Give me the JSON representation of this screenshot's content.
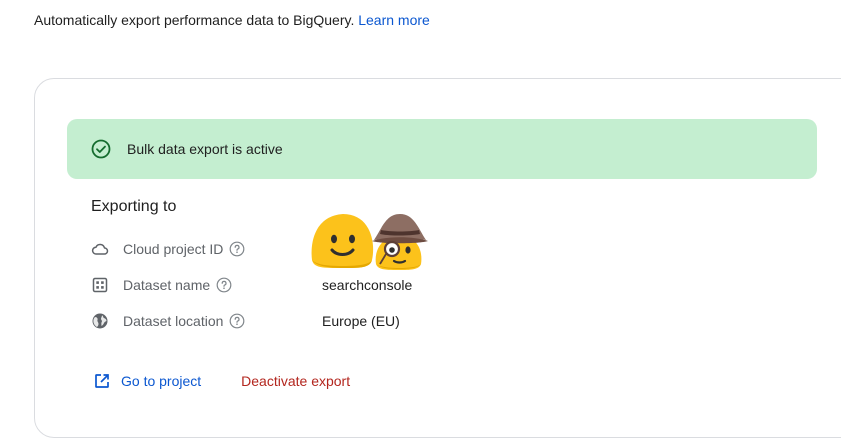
{
  "intro": {
    "text": "Automatically export performance data to BigQuery.",
    "learn_more": "Learn more"
  },
  "banner": {
    "icon": "check-circle-icon",
    "text": "Bulk data export is active",
    "color": "#c4eed0"
  },
  "exporting": {
    "title": "Exporting to",
    "rows": [
      {
        "icon": "cloud-icon",
        "label": "Cloud project ID",
        "value": ""
      },
      {
        "icon": "dataset-grid-icon",
        "label": "Dataset name",
        "value": "searchconsole"
      },
      {
        "icon": "globe-icon",
        "label": "Dataset location",
        "value": "Europe (EU)"
      }
    ]
  },
  "actions": {
    "go_to_project": "Go to project",
    "deactivate": "Deactivate export",
    "link_color": "#0b57d0",
    "danger_color": "#b3261e"
  }
}
